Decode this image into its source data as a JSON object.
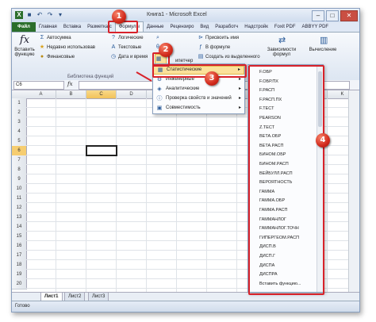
{
  "window": {
    "title": "Книга1 - Microsoft Excel",
    "file_icon": "excel-icon"
  },
  "tabs": [
    {
      "label": "Файл",
      "kind": "file"
    },
    {
      "label": "Главная"
    },
    {
      "label": "Вставка"
    },
    {
      "label": "Разметка с"
    },
    {
      "label": "Формулы",
      "active": true
    },
    {
      "label": "Данные"
    },
    {
      "label": "Рецензиро"
    },
    {
      "label": "Вид"
    },
    {
      "label": "Разработч"
    },
    {
      "label": "Надстройк"
    },
    {
      "label": "Foxit PDF"
    },
    {
      "label": "ABBYY PDF"
    }
  ],
  "ribbon": {
    "insert_function": "Вставить функцию",
    "autosum": "Автосумма",
    "recent": "Недавно использовав",
    "financial": "Финансовые",
    "logical": "Логические",
    "text": "Текстовые",
    "datetime": "Дата и время",
    "group_label": "Библиотека функций",
    "assign_name": "Присвоить имя",
    "in_formula": "В формуле",
    "create_from_selection": "Создать из выделенного",
    "dispatcher": "ипетчер",
    "dependencies": "Зависимости формул",
    "calculation": "Вычисление"
  },
  "formula_bar": {
    "name_box": "C6",
    "fx": "fx"
  },
  "grid": {
    "columns": [
      "A",
      "B",
      "C",
      "D",
      "E",
      "F",
      "G",
      "H",
      "I",
      "J",
      "K",
      "L"
    ],
    "rows": [
      "1",
      "2",
      "3",
      "4",
      "5",
      "6",
      "7",
      "8",
      "9",
      "10",
      "11",
      "12",
      "13",
      "14",
      "15",
      "16",
      "17",
      "18",
      "19",
      "20"
    ],
    "selected_col": "C",
    "selected_row": "6"
  },
  "sheets": [
    "Лист1",
    "Лист2",
    "Лист3"
  ],
  "status": {
    "ready": "Готово"
  },
  "menu_more": [
    {
      "label": "Статистические",
      "icon": "stats-icon",
      "highlight": true
    },
    {
      "label": "Инженерные",
      "icon": "engineering-icon"
    },
    {
      "label": "Аналитические",
      "icon": "cube-icon"
    },
    {
      "label": "Проверка свойств и значений",
      "icon": "info-icon"
    },
    {
      "label": "Совместимость",
      "icon": "compat-icon"
    }
  ],
  "stat_functions": [
    "F.ОБР",
    "F.ОБР.ПХ",
    "F.РАСП",
    "F.РАСП.ПХ",
    "F.ТЕСТ",
    "PEARSON",
    "Z.ТЕСТ",
    "ВЕТА.ОБР",
    "ВЕТА.РАСП",
    "БИНОМ.ОБР",
    "БИНОМ.РАСП",
    "ВЕЙБУЛЛ.РАСП",
    "ВЕРОЯТНОСТЬ",
    "ГАММА",
    "ГАММА.ОБР",
    "ГАММА.РАСП",
    "ГАММАНЛОГ",
    "ГАММАНЛОГ.ТОЧН",
    "ГИПЕРГЕОМ.РАСП",
    "ДИСП.В",
    "ДИСП.Г",
    "ДИСПА",
    "ДИСПРА",
    "Вставить функцию..."
  ],
  "badges": [
    "1",
    "2",
    "3",
    "4"
  ],
  "colors": {
    "callout": "#d8222a",
    "file_tab": "#2b6e2b",
    "highlight": "#fbe19a"
  }
}
